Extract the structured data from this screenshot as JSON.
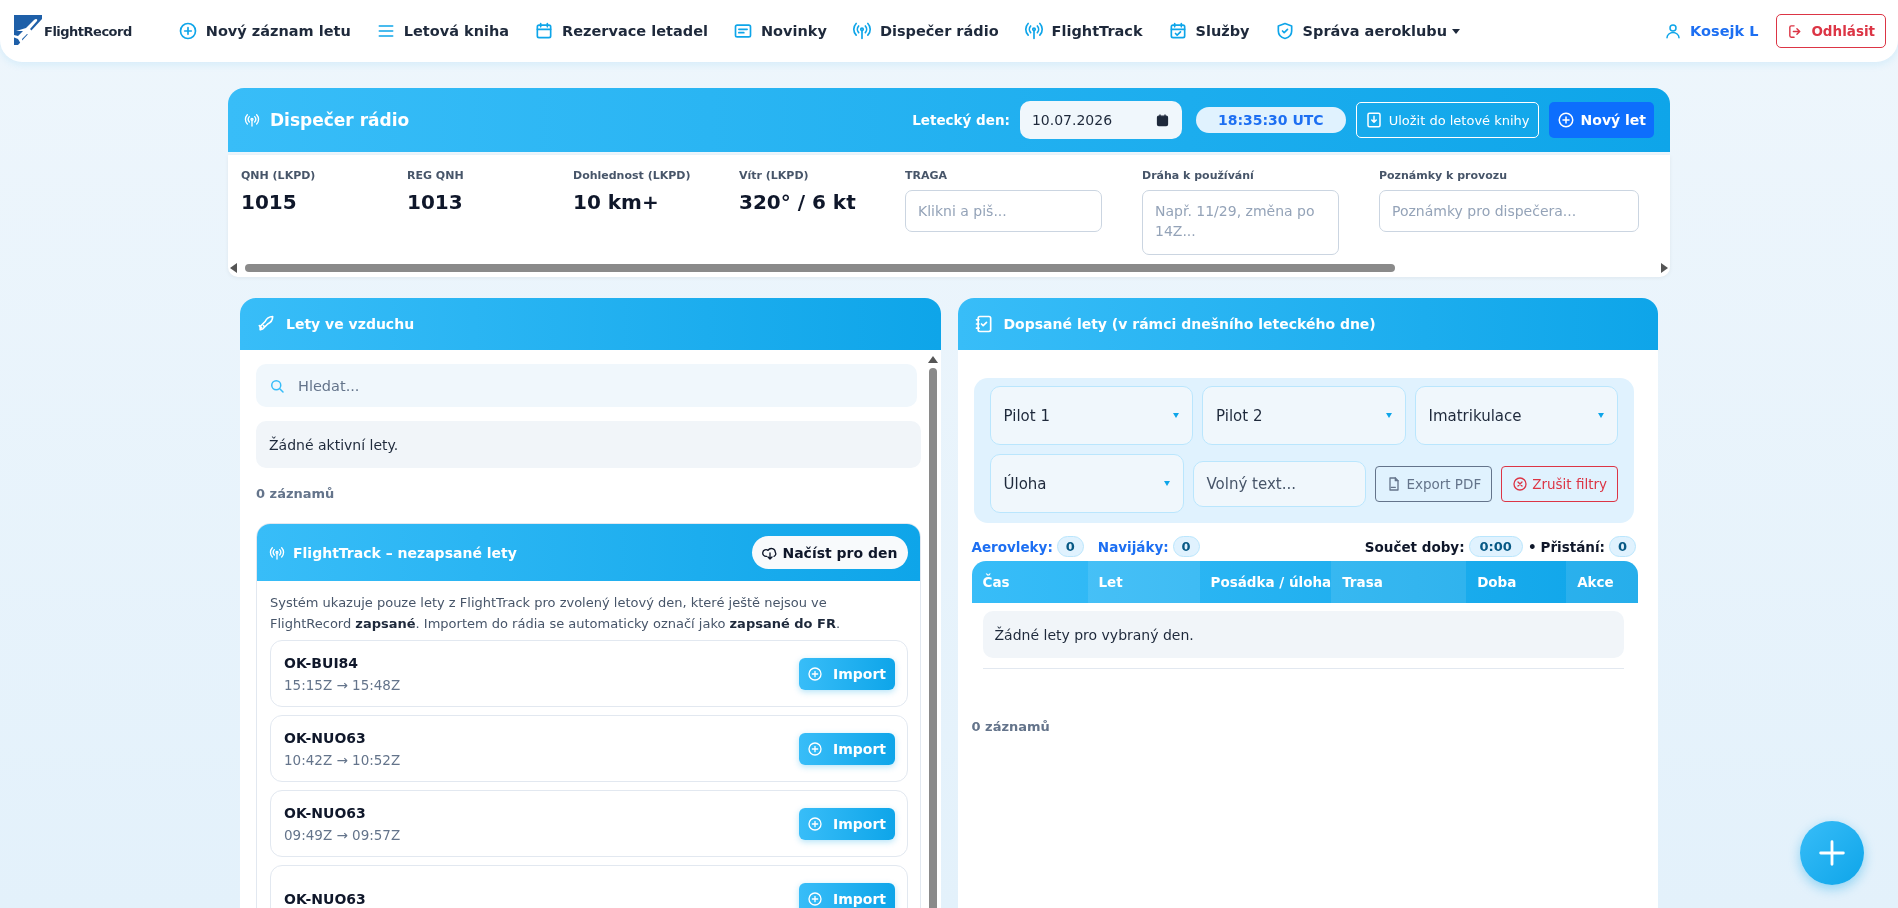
{
  "nav": {
    "brand": "FlightRecord",
    "items": [
      {
        "label": "Nový záznam letu",
        "dropdown": false
      },
      {
        "label": "Letová kniha",
        "dropdown": false
      },
      {
        "label": "Rezervace letadel",
        "dropdown": false
      },
      {
        "label": "Novinky",
        "dropdown": false
      },
      {
        "label": "Dispečer rádio",
        "dropdown": false
      },
      {
        "label": "FlightTrack",
        "dropdown": false
      },
      {
        "label": "Služby",
        "dropdown": false
      },
      {
        "label": "Správa aeroklubu",
        "dropdown": true
      }
    ],
    "user": "Kosejk L",
    "logout": "Odhlásit"
  },
  "dispatcher": {
    "title": "Dispečer rádio",
    "day_label": "Letecký den:",
    "date": "10.07.2026",
    "clock": "18:35:30 UTC",
    "save_button": "Uložit do letové knihy",
    "new_button": "Nový let"
  },
  "metrics": [
    {
      "kind": "value",
      "label": "QNH (LKPD)",
      "value": "1015"
    },
    {
      "kind": "value",
      "label": "REG QNH",
      "value": "1013"
    },
    {
      "kind": "value",
      "label": "Dohlednost (LKPD)",
      "value": "10 km+"
    },
    {
      "kind": "value",
      "label": "Vítr (LKPD)",
      "value": "320° / 6 kt"
    },
    {
      "kind": "input",
      "label": "TRAGA",
      "placeholder": "Klikni a piš..."
    },
    {
      "kind": "textarea",
      "label": "Dráha k používání",
      "placeholder": "Např. 11/29, změna po 14Z..."
    },
    {
      "kind": "input",
      "label": "Poznámky k provozu",
      "placeholder": "Poznámky pro dispečera..."
    }
  ],
  "air_panel": {
    "title": "Lety ve vzduchu",
    "search": {
      "placeholder": "Hledat..."
    },
    "empty": "Žádné aktivní lety.",
    "count": "0 záznamů",
    "flighttrack": {
      "title": "FlightTrack – nezapsané lety",
      "load_button": "Načíst pro den",
      "note": "Systém ukazuje pouze lety z FlightTrack pro zvolený letový den, které ještě nejsou ve FlightRecord **zapsané**. Importem do rádia se automaticky označí jako **zapsané do FR**.",
      "flights": [
        {
          "registration": "OK-BUI84",
          "times": "15:15Z → 15:48Z",
          "button": "Import"
        },
        {
          "registration": "OK-NUO63",
          "times": "10:42Z → 10:52Z",
          "button": "Import"
        },
        {
          "registration": "OK-NUO63",
          "times": "09:49Z → 09:57Z",
          "button": "Import"
        },
        {
          "registration": "OK-NUO63",
          "button": "Import"
        }
      ]
    }
  },
  "logged_panel": {
    "title": "Dopsané lety (v rámci dnešního leteckého dne)",
    "filters": [
      {
        "kind": "select",
        "label": "Pilot 1"
      },
      {
        "kind": "select",
        "label": "Pilot 2"
      },
      {
        "kind": "select",
        "label": "Imatrikulace"
      },
      {
        "kind": "select",
        "label": "Úloha"
      },
      {
        "kind": "text",
        "placeholder": "Volný text..."
      }
    ],
    "export_button": "Export PDF",
    "clear_button": "Zrušit filtry",
    "stats": {
      "aerotows_label": "Aerovleky:",
      "aerotows": "0",
      "winches_label": "Navijáky:",
      "winches": "0",
      "total_label": "Součet doby:",
      "total": "0:00",
      "separator": "•",
      "landings_label": "Přistání:",
      "landings": "0"
    },
    "columns": [
      "Čas",
      "Let",
      "Posádka / úloha",
      "Trasa",
      "Doba",
      "Akce"
    ],
    "empty": "Žádné lety pro vybraný den.",
    "count": "0 záznamů"
  }
}
